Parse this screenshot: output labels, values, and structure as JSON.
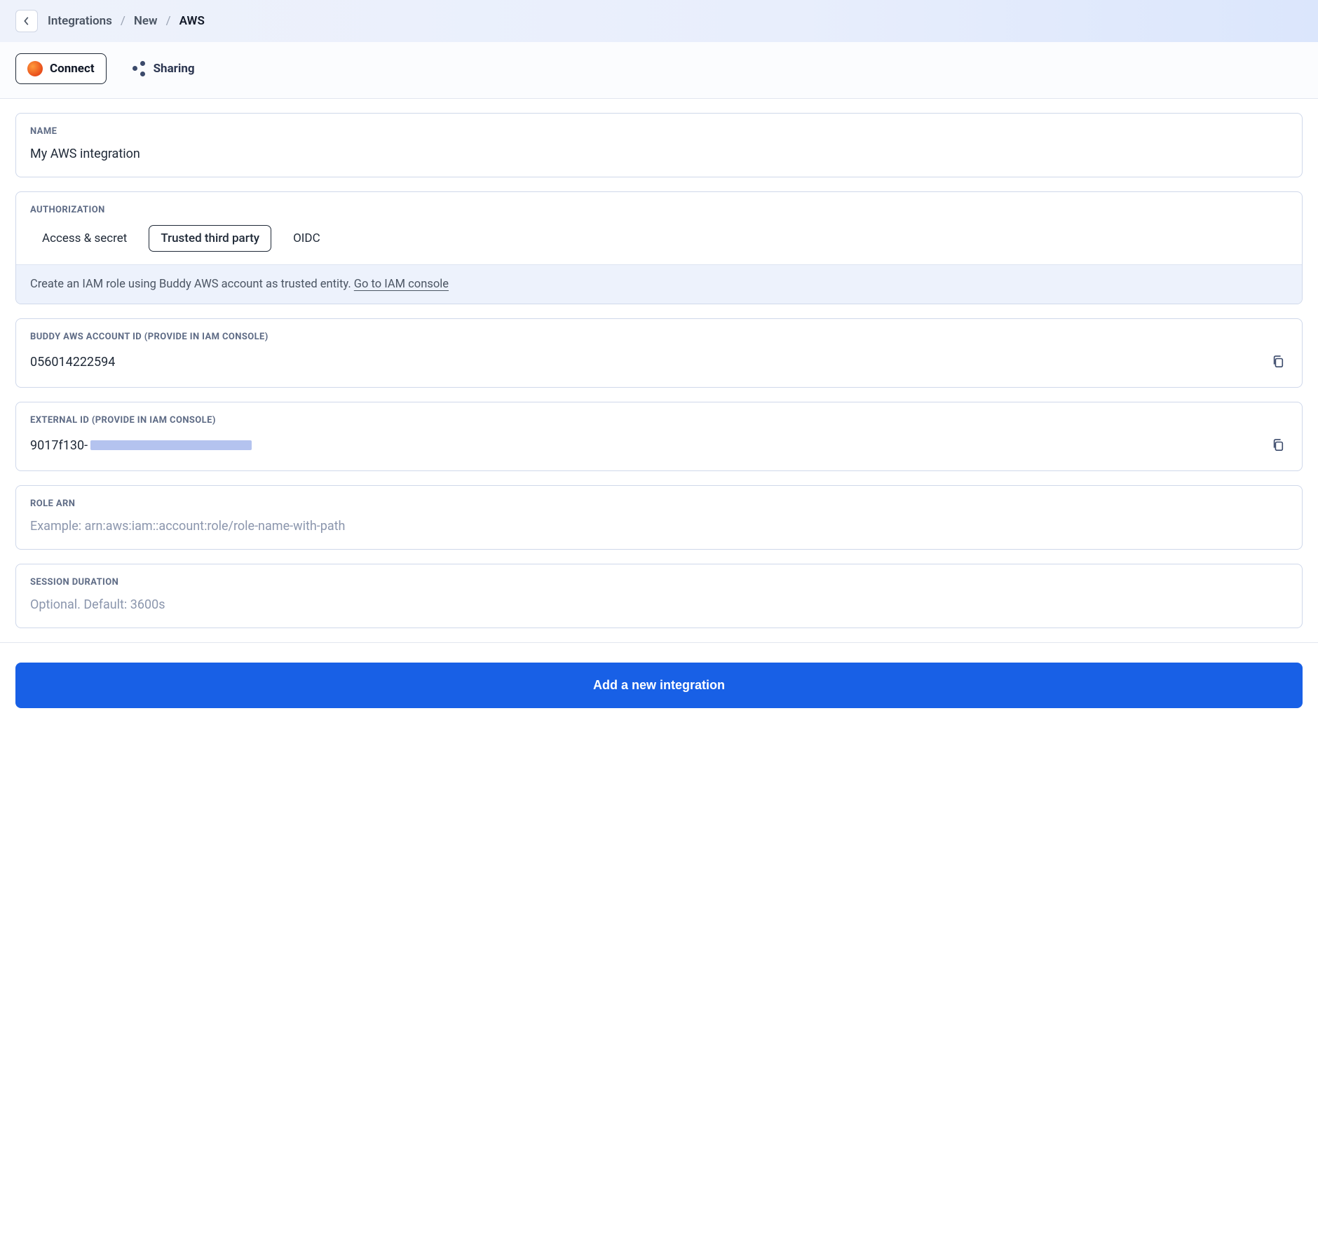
{
  "breadcrumb": {
    "items": [
      "Integrations",
      "New",
      "AWS"
    ]
  },
  "tabs": {
    "connect": "Connect",
    "sharing": "Sharing"
  },
  "name_section": {
    "label": "NAME",
    "value": "My AWS integration"
  },
  "auth_section": {
    "label": "AUTHORIZATION",
    "options": {
      "access_secret": "Access & secret",
      "trusted": "Trusted third party",
      "oidc": "OIDC"
    },
    "info_text": "Create an IAM role using Buddy AWS account as trusted entity. ",
    "info_link": "Go to IAM console"
  },
  "account_id_section": {
    "label": "BUDDY AWS ACCOUNT ID (PROVIDE IN IAM CONSOLE)",
    "value": "056014222594"
  },
  "external_id_section": {
    "label": "EXTERNAL ID (PROVIDE IN IAM CONSOLE)",
    "value_prefix": "9017f130-"
  },
  "role_arn_section": {
    "label": "ROLE ARN",
    "placeholder": "Example: arn:aws:iam::account:role/role-name-with-path"
  },
  "session_duration_section": {
    "label": "SESSION DURATION",
    "placeholder": "Optional. Default: 3600s"
  },
  "submit_label": "Add a new integration"
}
